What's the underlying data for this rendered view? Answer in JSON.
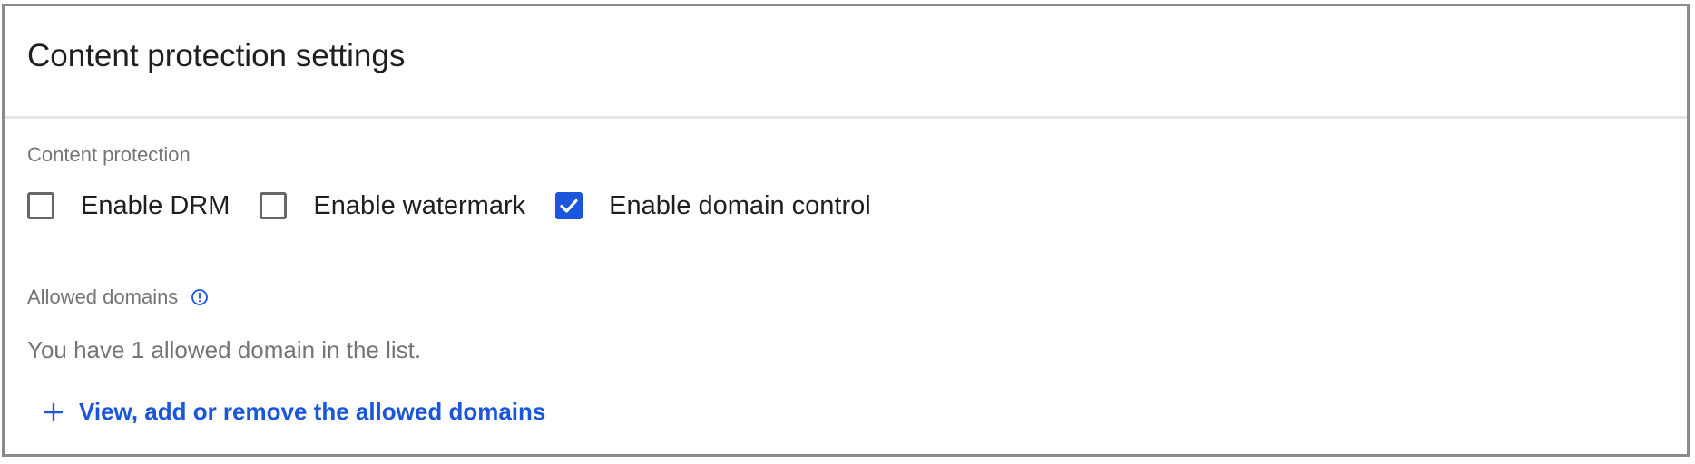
{
  "header": {
    "title": "Content protection settings"
  },
  "content_protection": {
    "label": "Content protection",
    "options": [
      {
        "label": "Enable DRM",
        "checked": false
      },
      {
        "label": "Enable watermark",
        "checked": false
      },
      {
        "label": "Enable domain control",
        "checked": true
      }
    ]
  },
  "allowed_domains": {
    "label": "Allowed domains",
    "info_icon": "info-icon",
    "description": "You have 1 allowed domain in the list.",
    "link_label": "View, add or remove the allowed domains",
    "link_icon": "plus-icon"
  },
  "colors": {
    "accent": "#1a56db",
    "label_gray": "#757575",
    "border": "#8a8a8a"
  }
}
